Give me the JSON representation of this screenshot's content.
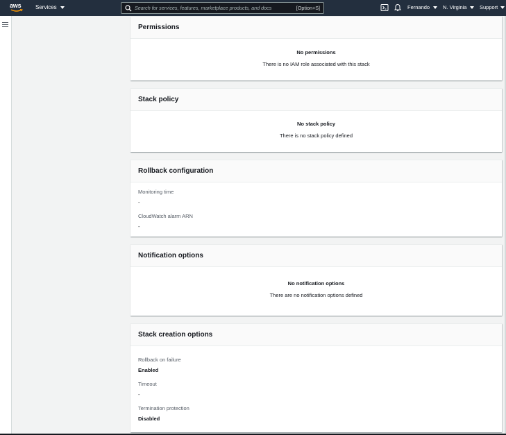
{
  "topnav": {
    "logo_text": "aws",
    "services_label": "Services",
    "search_placeholder": "Search for services, features, marketplace products, and docs",
    "search_shortcut": "[Option+S]",
    "user_label": "Fernando",
    "region_label": "N. Virginia",
    "support_label": "Support"
  },
  "panels": {
    "permissions": {
      "title": "Permissions",
      "empty_title": "No permissions",
      "empty_desc": "There is no IAM role associated with this stack"
    },
    "stack_policy": {
      "title": "Stack policy",
      "empty_title": "No stack policy",
      "empty_desc": "There is no stack policy defined"
    },
    "rollback": {
      "title": "Rollback configuration",
      "monitoring_label": "Monitoring time",
      "monitoring_value": "-",
      "alarm_label": "CloudWatch alarm ARN",
      "alarm_value": "-"
    },
    "notification": {
      "title": "Notification options",
      "empty_title": "No notification options",
      "empty_desc": "There are no notification options defined"
    },
    "creation": {
      "title": "Stack creation options",
      "rollback_label": "Rollback on failure",
      "rollback_value": "Enabled",
      "timeout_label": "Timeout",
      "timeout_value": "-",
      "termination_label": "Termination protection",
      "termination_value": "Disabled"
    }
  },
  "colors": {
    "nav_bg": "#232f3e",
    "aws_orange": "#ff9900",
    "page_bg": "#f2f3f3",
    "panel_header_bg": "#fafafa"
  }
}
